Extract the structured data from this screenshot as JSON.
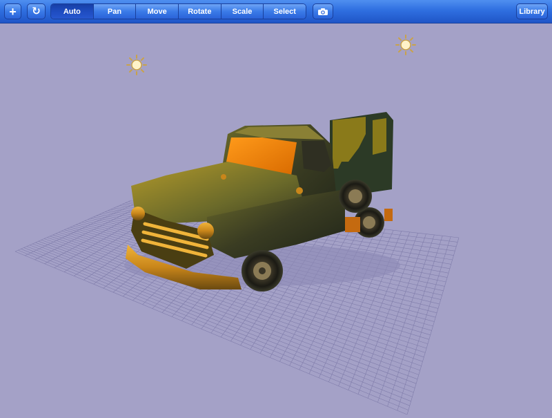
{
  "toolbar": {
    "add_icon_glyph": "+",
    "refresh_icon_glyph": "↻",
    "modes": [
      {
        "label": "Auto",
        "active": true
      },
      {
        "label": "Pan",
        "active": false
      },
      {
        "label": "Move",
        "active": false
      },
      {
        "label": "Rotate",
        "active": false
      },
      {
        "label": "Scale",
        "active": false
      },
      {
        "label": "Select",
        "active": false
      }
    ],
    "library_label": "Library"
  },
  "scene": {
    "background_color": "#a4a1c7",
    "grid_color": "#7f7caa",
    "model": "pickup-truck",
    "lights": [
      "light-icon",
      "light-icon"
    ]
  },
  "colors": {
    "toolbar_blue": "#2f6fe0",
    "active_segment": "#1e4cc0"
  }
}
